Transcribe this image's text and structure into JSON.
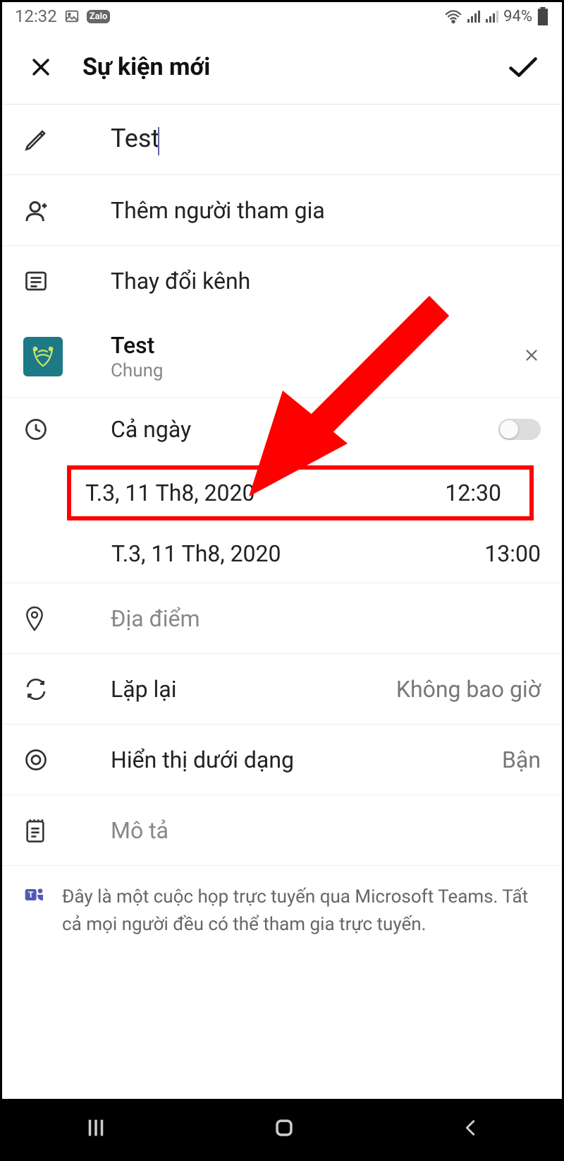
{
  "statusBar": {
    "time": "12:32",
    "battery": "94%"
  },
  "header": {
    "title": "Sự kiện mới"
  },
  "form": {
    "titleValue": "Test",
    "addParticipants": "Thêm người tham gia",
    "changeChannel": "Thay đổi kênh",
    "team": {
      "name": "Test",
      "channel": "Chung"
    },
    "allDay": "Cả ngày",
    "startDate": "T.3, 11 Th8, 2020",
    "startTime": "12:30",
    "endDate": "T.3, 11 Th8, 2020",
    "endTime": "13:00",
    "locationPlaceholder": "Địa điểm",
    "repeatLabel": "Lặp lại",
    "repeatValue": "Không bao giờ",
    "showAsLabel": "Hiển thị dưới dạng",
    "showAsValue": "Bận",
    "descriptionPlaceholder": "Mô tả"
  },
  "footer": {
    "line1": "Đây là một cuộc họp trực tuyến qua Microsoft Teams.",
    "line2": "Tất cả mọi người đều có thể tham gia trực tuyến."
  }
}
